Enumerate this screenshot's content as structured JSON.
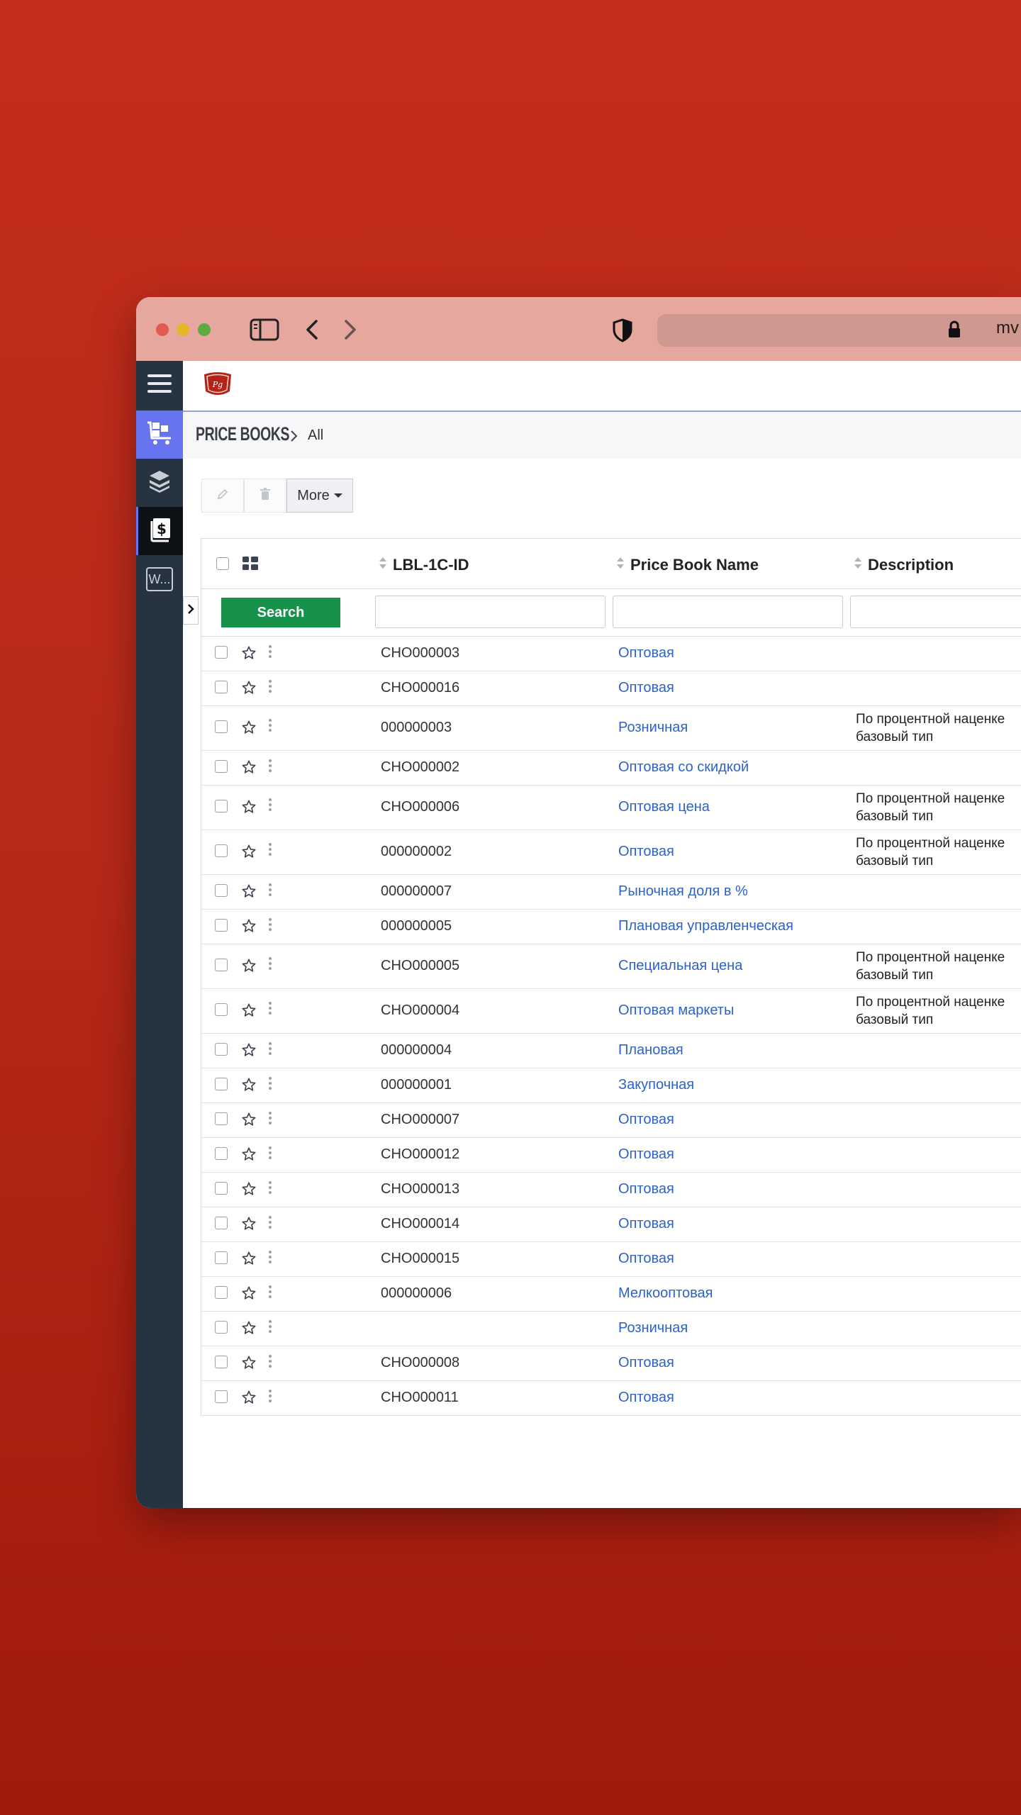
{
  "browser": {
    "url_fragment": "mv"
  },
  "breadcrumb": {
    "module": "PRICE BOOKS",
    "view": "All"
  },
  "actions": {
    "more_label": "More"
  },
  "table": {
    "columns": [
      "LBL-1C-ID",
      "Price Book Name",
      "Description"
    ],
    "search_label": "Search",
    "rows": [
      {
        "id": "CHO000003",
        "name": "Оптовая",
        "desc1": "",
        "desc2": ""
      },
      {
        "id": "CHO000016",
        "name": "Оптовая",
        "desc1": "",
        "desc2": ""
      },
      {
        "id": "000000003",
        "name": "Розничная",
        "desc1": "По процентной наценке",
        "desc2": "базовый тип"
      },
      {
        "id": "CHO000002",
        "name": "Оптовая со скидкой",
        "desc1": "",
        "desc2": ""
      },
      {
        "id": "CHO000006",
        "name": "Оптовая цена",
        "desc1": "По процентной наценке",
        "desc2": "базовый тип"
      },
      {
        "id": "000000002",
        "name": "Оптовая",
        "desc1": "По процентной наценке",
        "desc2": "базовый тип"
      },
      {
        "id": "000000007",
        "name": "Рыночная доля в %",
        "desc1": "",
        "desc2": ""
      },
      {
        "id": "000000005",
        "name": "Плановая управленческая",
        "desc1": "",
        "desc2": ""
      },
      {
        "id": "CHO000005",
        "name": "Специальная цена",
        "desc1": "По процентной наценке",
        "desc2": "базовый тип"
      },
      {
        "id": "CHO000004",
        "name": "Оптовая маркеты",
        "desc1": "По процентной наценке",
        "desc2": "базовый тип"
      },
      {
        "id": "000000004",
        "name": "Плановая",
        "desc1": "",
        "desc2": ""
      },
      {
        "id": "000000001",
        "name": "Закупочная",
        "desc1": "",
        "desc2": ""
      },
      {
        "id": "CHO000007",
        "name": "Оптовая",
        "desc1": "",
        "desc2": ""
      },
      {
        "id": "CHO000012",
        "name": "Оптовая",
        "desc1": "",
        "desc2": ""
      },
      {
        "id": "CHO000013",
        "name": "Оптовая",
        "desc1": "",
        "desc2": ""
      },
      {
        "id": "CHO000014",
        "name": "Оптовая",
        "desc1": "",
        "desc2": ""
      },
      {
        "id": "CHO000015",
        "name": "Оптовая",
        "desc1": "",
        "desc2": ""
      },
      {
        "id": "000000006",
        "name": "Мелкооптовая",
        "desc1": "",
        "desc2": ""
      },
      {
        "id": "",
        "name": "Розничная",
        "desc1": "",
        "desc2": ""
      },
      {
        "id": "CHO000008",
        "name": "Оптовая",
        "desc1": "",
        "desc2": ""
      },
      {
        "id": "CHO000011",
        "name": "Оптовая",
        "desc1": "",
        "desc2": ""
      }
    ]
  },
  "sidebar": {
    "w_label": "W..."
  },
  "colors": {
    "background": "#c42d1b",
    "titlebar": "#e6a79f",
    "nav_dark": "#263442",
    "nav_accent": "#6773ef",
    "search_green": "#16924a",
    "link_blue": "#2d63c8"
  },
  "icons": [
    "sidebar-toggle-icon",
    "back-icon",
    "forward-icon",
    "shield-icon",
    "lock-icon",
    "hamburger-icon",
    "cart-icon",
    "packages-icon",
    "dollar-book-icon",
    "pencil-icon",
    "trash-icon",
    "grid-icon",
    "sort-icon",
    "star-icon",
    "kebab-icon",
    "chevron-right-icon"
  ]
}
